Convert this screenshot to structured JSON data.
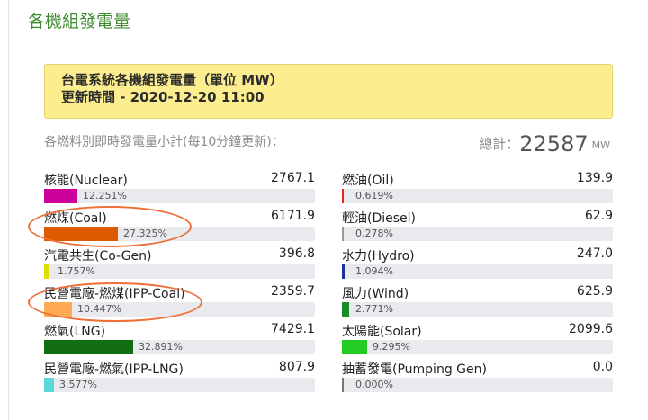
{
  "header": {
    "title": "各機組發電量"
  },
  "banner": {
    "line1": "台電系統各機組發電量（單位 MW）",
    "line2": "更新時間 - 2020-12-20 11:00"
  },
  "subtitle": "各燃料別即時發電量小計(每10分鐘更新)：",
  "total": {
    "label": "總計：",
    "value": "22587",
    "unit": "MW"
  },
  "items": [
    {
      "name": "核能(Nuclear)",
      "value": "2767.1",
      "percent": "12.251%",
      "pct": 12.251,
      "color": "#cc0099"
    },
    {
      "name": "燃煤(Coal)",
      "value": "6171.9",
      "percent": "27.325%",
      "pct": 27.325,
      "color": "#dd5a00"
    },
    {
      "name": "汽電共生(Co-Gen)",
      "value": "396.8",
      "percent": "1.757%",
      "pct": 1.757,
      "color": "#dede00"
    },
    {
      "name": "民營電廠-燃煤(IPP-Coal)",
      "value": "2359.7",
      "percent": "10.447%",
      "pct": 10.447,
      "color": "#ffaa55"
    },
    {
      "name": "燃氣(LNG)",
      "value": "7429.1",
      "percent": "32.891%",
      "pct": 32.891,
      "color": "#136e13"
    },
    {
      "name": "民營電廠-燃氣(IPP-LNG)",
      "value": "807.9",
      "percent": "3.577%",
      "pct": 3.577,
      "color": "#5ad7d7"
    },
    {
      "name": "燃油(Oil)",
      "value": "139.9",
      "percent": "0.619%",
      "pct": 0.619,
      "color": "#ee2222"
    },
    {
      "name": "輕油(Diesel)",
      "value": "62.9",
      "percent": "0.278%",
      "pct": 0.278,
      "color": "#999999"
    },
    {
      "name": "水力(Hydro)",
      "value": "247.0",
      "percent": "1.094%",
      "pct": 1.094,
      "color": "#1f2f9f"
    },
    {
      "name": "風力(Wind)",
      "value": "625.9",
      "percent": "2.771%",
      "pct": 2.771,
      "color": "#1a8c2a"
    },
    {
      "name": "太陽能(Solar)",
      "value": "2099.6",
      "percent": "9.295%",
      "pct": 9.295,
      "color": "#22cc22"
    },
    {
      "name": "抽蓄發電(Pumping Gen)",
      "value": "0.0",
      "percent": "0.000%",
      "pct": 0.0,
      "color": "#777777"
    }
  ],
  "annotations": {
    "circle_color": "#ef6e36",
    "circled_items": [
      "燃煤(Coal)",
      "民營電廠-燃煤(IPP-Coal)"
    ]
  }
}
